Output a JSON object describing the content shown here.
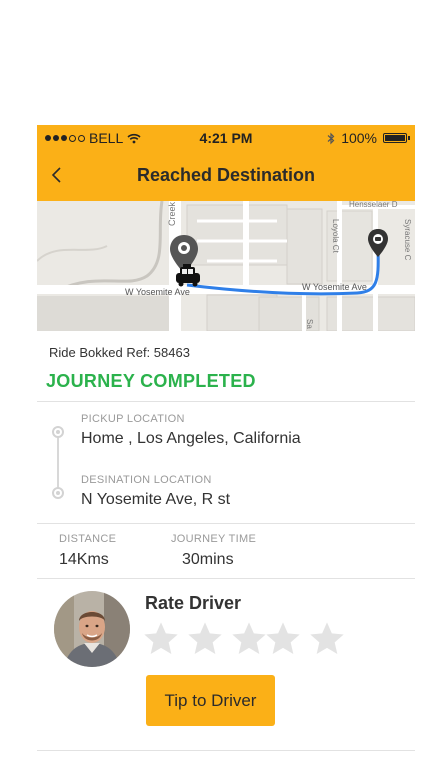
{
  "statusbar": {
    "carrier": "BELL",
    "time": "4:21 PM",
    "battery": "100%"
  },
  "navbar": {
    "title": "Reached Destination"
  },
  "map": {
    "street_label": "W Yosemite Ave",
    "street_label_2": "W Yosemite Ave",
    "creek_label": "Creek",
    "street_hensselaer": "Hensselaer D",
    "street_loyola": "Loyola Ct",
    "street_syracuse": "Syracuse C",
    "street_sa": "Sa"
  },
  "ride": {
    "ref_label": "Ride Bokked Ref:",
    "ref_value": "58463",
    "status": "JOURNEY COMPLETED"
  },
  "pickup": {
    "label": "PICKUP LOCATION",
    "value": "Home , Los Angeles, California"
  },
  "destination": {
    "label": "DESINATION LOCATION",
    "value": "N Yosemite Ave, R st"
  },
  "stats": {
    "distance_label": "DISTANCE",
    "distance_value": "14Kms",
    "time_label": "JOURNEY TIME",
    "time_value": "30mins"
  },
  "rating": {
    "title": "Rate Driver",
    "max_stars": 5,
    "value": 0
  },
  "tip": {
    "label": "Tip to Driver"
  },
  "colors": {
    "accent": "#fbb017",
    "success": "#2bb24c",
    "route": "#2f7fe8"
  }
}
